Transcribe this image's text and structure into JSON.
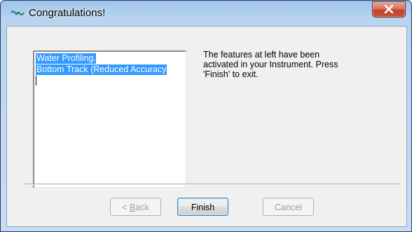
{
  "window": {
    "title": "Congratulations!",
    "close_label": "×"
  },
  "list": {
    "items": [
      "Water Profiling.",
      "Bottom Track (Reduced Accuracy"
    ]
  },
  "info": {
    "lines": [
      "The features at left have been",
      "activated in your Instrument.  Press",
      "'Finish' to exit."
    ]
  },
  "buttons": {
    "back_prefix": "< ",
    "back_mnemonic": "B",
    "back_rest": "ack",
    "finish": "Finish",
    "cancel": "Cancel"
  },
  "colors": {
    "selection": "#3399ff",
    "title_gradient_top": "#9fc3e8",
    "close_button": "#c3402a"
  },
  "icons": {
    "app": "app-logo-icon",
    "close": "close-icon"
  }
}
